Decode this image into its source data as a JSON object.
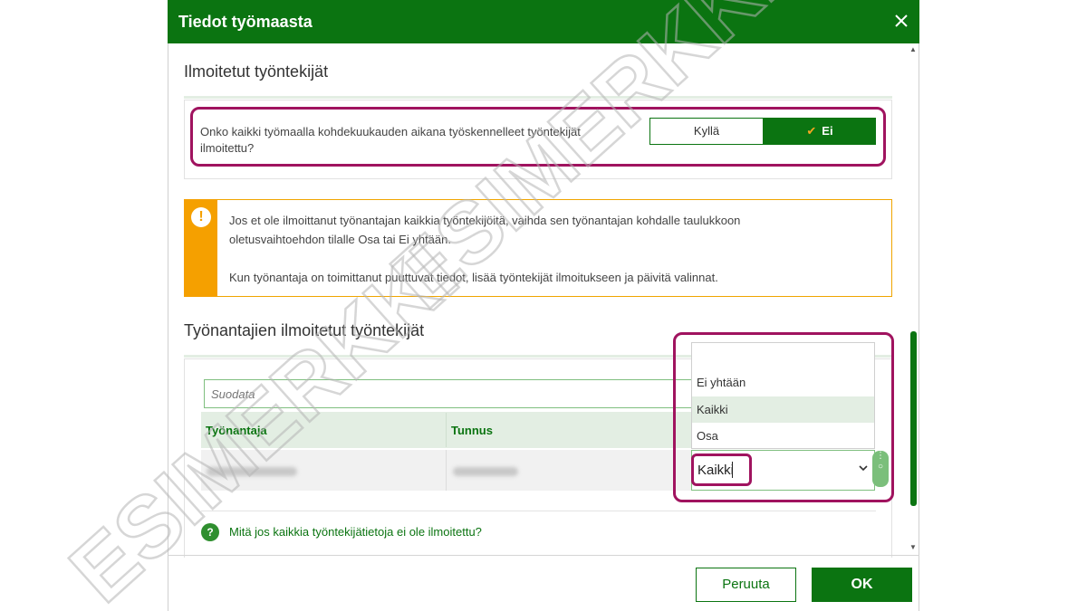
{
  "dialog": {
    "title": "Tiedot työmaasta"
  },
  "reported_section": {
    "title": "Ilmoitetut työntekijät",
    "question": "Onko kaikki työmaalla kohdekuukauden aikana työskennelleet työntekijät ilmoitettu?",
    "yes_label": "Kyllä",
    "no_label": "Ei",
    "selected": "Ei"
  },
  "warning": {
    "line1": "Jos et ole ilmoittanut työnantajan kaikkia työntekijöitä, vaihda sen työnantajan kohdalle taulukkoon",
    "line2": "oletusvaihtoehdon tilalle Osa tai Ei yhtään.",
    "line3": "Kun työnantaja on toimittanut puuttuvat tiedot, lisää työntekijät ilmoitukseen ja päivitä valinnat."
  },
  "employers_section": {
    "title": "Työnantajien ilmoitetut työntekijät",
    "filter_placeholder": "Suodata",
    "columns": [
      "Työnantaja",
      "Tunnus"
    ],
    "dropdown": {
      "options": [
        "Ei yhtään",
        "Kaikki",
        "Osa"
      ],
      "highlighted": "Kaikki",
      "current_value": "Kaikki"
    }
  },
  "help": {
    "link_text": "Mitä jos kaikkia työntekijätietoja ei ole ilmoitettu?"
  },
  "footer": {
    "cancel_label": "Peruuta",
    "ok_label": "OK"
  },
  "watermark": {
    "text": "ESIMERKKI"
  },
  "colors": {
    "brand_green": "#0b7411",
    "warning_orange": "#f5a000",
    "highlight_magenta": "#a0135f"
  }
}
